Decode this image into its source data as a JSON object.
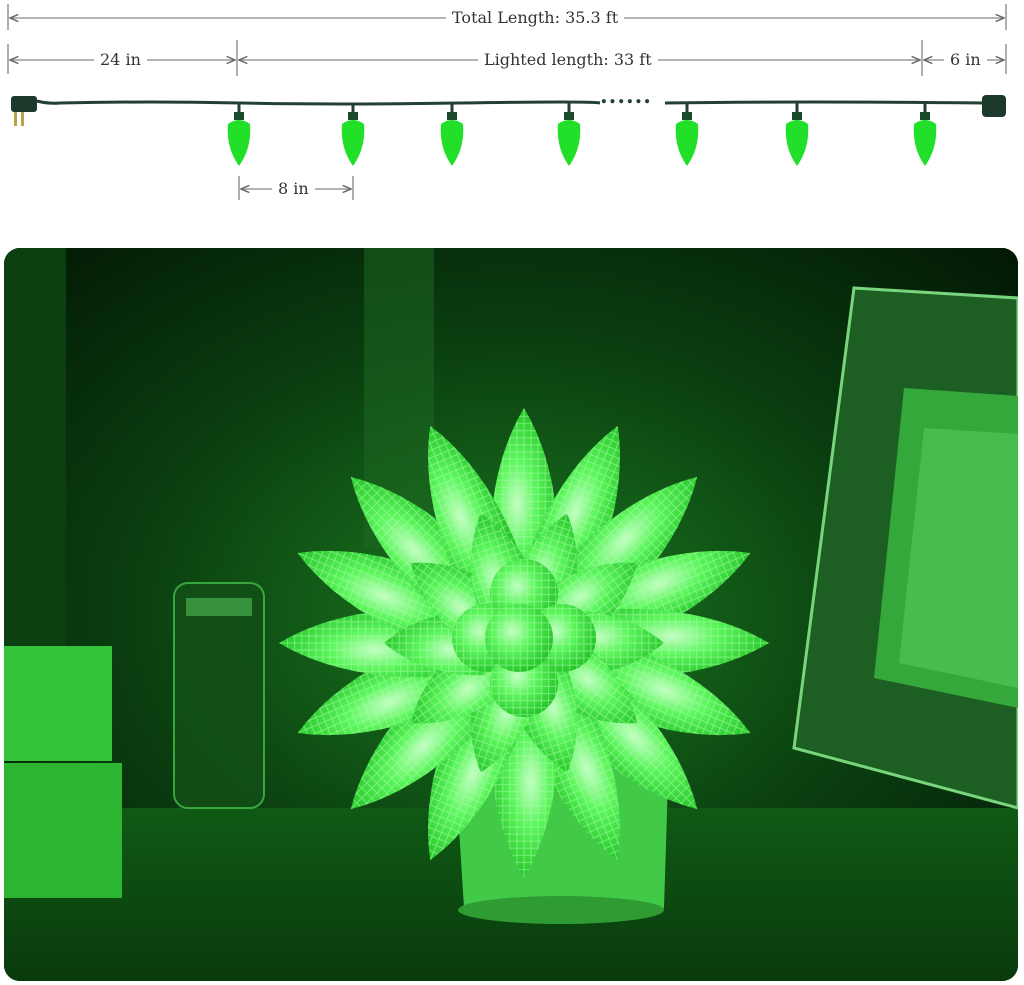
{
  "dimensions": {
    "total_length": "Total Length: 35.3 ft",
    "lead_length": "24 in",
    "lighted_length": "Lighted length: 33 ft",
    "tail_length": "6 in",
    "bulb_spacing": "8 in",
    "ellipsis": "......"
  },
  "colors": {
    "wire": "#234034",
    "bulb": "#22e02a",
    "dimension_line": "#666666",
    "text": "#333333"
  },
  "photo": {
    "description_icon": "green-c9-bulb-bouquet-photo"
  }
}
